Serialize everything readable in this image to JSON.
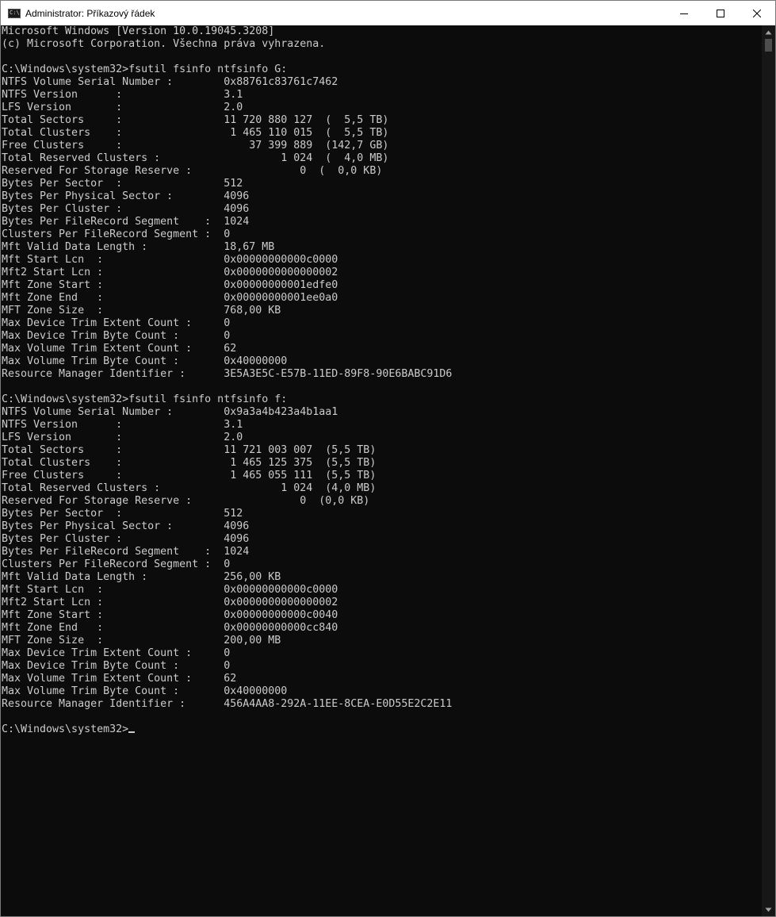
{
  "window": {
    "title": "Administrator: Příkazový řádek",
    "icon_label": "C:\\",
    "icons": {
      "app": "console-app-icon",
      "minimize": "minimize-icon",
      "maximize": "maximize-icon",
      "close": "close-icon",
      "scroll_up": "chevron-up-icon",
      "scroll_down": "chevron-down-icon"
    }
  },
  "colors": {
    "console_background": "#0c0c0c",
    "console_text": "#cccccc",
    "titlebar": "#ffffff"
  },
  "console": {
    "lines": [
      "Microsoft Windows [Version 10.0.19045.3208]",
      "(c) Microsoft Corporation. Všechna práva vyhrazena.",
      "",
      "C:\\Windows\\system32>fsutil fsinfo ntfsinfo G:",
      "NTFS Volume Serial Number :        0x88761c83761c7462",
      "NTFS Version      :                3.1",
      "LFS Version       :                2.0",
      "Total Sectors     :                11 720 880 127  (  5,5 TB)",
      "Total Clusters    :                 1 465 110 015  (  5,5 TB)",
      "Free Clusters     :                    37 399 889  (142,7 GB)",
      "Total Reserved Clusters :                   1 024  (  4,0 MB)",
      "Reserved For Storage Reserve :                 0  (  0,0 KB)",
      "Bytes Per Sector  :                512",
      "Bytes Per Physical Sector :        4096",
      "Bytes Per Cluster :                4096",
      "Bytes Per FileRecord Segment    :  1024",
      "Clusters Per FileRecord Segment :  0",
      "Mft Valid Data Length :            18,67 MB",
      "Mft Start Lcn  :                   0x00000000000c0000",
      "Mft2 Start Lcn :                   0x0000000000000002",
      "Mft Zone Start :                   0x00000000001edfe0",
      "Mft Zone End   :                   0x00000000001ee0a0",
      "MFT Zone Size  :                   768,00 KB",
      "Max Device Trim Extent Count :     0",
      "Max Device Trim Byte Count :       0",
      "Max Volume Trim Extent Count :     62",
      "Max Volume Trim Byte Count :       0x40000000",
      "Resource Manager Identifier :      3E5A3E5C-E57B-11ED-89F8-90E6BABC91D6",
      "",
      "C:\\Windows\\system32>fsutil fsinfo ntfsinfo f:",
      "NTFS Volume Serial Number :        0x9a3a4b423a4b1aa1",
      "NTFS Version      :                3.1",
      "LFS Version       :                2.0",
      "Total Sectors     :                11 721 003 007  (5,5 TB)",
      "Total Clusters    :                 1 465 125 375  (5,5 TB)",
      "Free Clusters     :                 1 465 055 111  (5,5 TB)",
      "Total Reserved Clusters :                   1 024  (4,0 MB)",
      "Reserved For Storage Reserve :                 0  (0,0 KB)",
      "Bytes Per Sector  :                512",
      "Bytes Per Physical Sector :        4096",
      "Bytes Per Cluster :                4096",
      "Bytes Per FileRecord Segment    :  1024",
      "Clusters Per FileRecord Segment :  0",
      "Mft Valid Data Length :            256,00 KB",
      "Mft Start Lcn  :                   0x00000000000c0000",
      "Mft2 Start Lcn :                   0x0000000000000002",
      "Mft Zone Start :                   0x00000000000c0040",
      "Mft Zone End   :                   0x00000000000cc840",
      "MFT Zone Size  :                   200,00 MB",
      "Max Device Trim Extent Count :     0",
      "Max Device Trim Byte Count :       0",
      "Max Volume Trim Extent Count :     62",
      "Max Volume Trim Byte Count :       0x40000000",
      "Resource Manager Identifier :      456A4AA8-292A-11EE-8CEA-E0D55E2C2E11",
      ""
    ],
    "prompt": "C:\\Windows\\system32>"
  }
}
